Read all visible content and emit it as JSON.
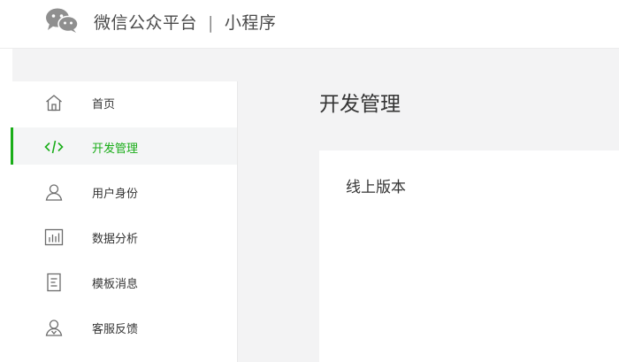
{
  "header": {
    "brand_name": "微信公众平台",
    "separator": "|",
    "product_name": "小程序",
    "logo_icon": "wechat-logo-icon"
  },
  "sidebar": {
    "items": [
      {
        "label": "首页",
        "icon": "home-icon",
        "active": false
      },
      {
        "label": "开发管理",
        "icon": "code-icon",
        "active": true
      },
      {
        "label": "用户身份",
        "icon": "user-icon",
        "active": false
      },
      {
        "label": "数据分析",
        "icon": "bar-chart-icon",
        "active": false
      },
      {
        "label": "模板消息",
        "icon": "document-icon",
        "active": false
      },
      {
        "label": "客服反馈",
        "icon": "customer-service-icon",
        "active": false
      }
    ]
  },
  "main": {
    "title": "开发管理",
    "card": {
      "title": "线上版本"
    }
  },
  "colors": {
    "accent": "#1aad19",
    "text": "#353535",
    "background": "#f3f3f4"
  }
}
